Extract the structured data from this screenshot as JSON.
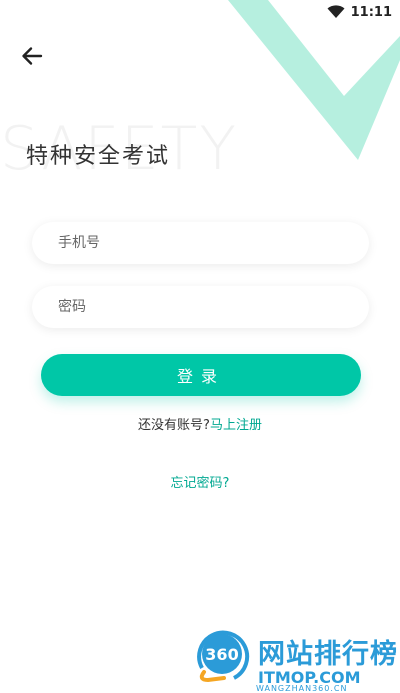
{
  "status_bar": {
    "time": "11:11",
    "wifi_icon": "wifi-icon"
  },
  "header": {
    "back_icon": "back-arrow-icon"
  },
  "background_text": "SAFETY",
  "page": {
    "title": "特种安全考试"
  },
  "form": {
    "phone_placeholder": "手机号",
    "password_placeholder": "密码",
    "login_label": "登录"
  },
  "links": {
    "no_account_text": "还没有账号?",
    "register_label": "马上注册",
    "forgot_label": "忘记密码?"
  },
  "watermark": {
    "logo_text": "360",
    "title": "网站排行榜",
    "domain": "ITMOP.COM",
    "subdomain": "WANGZHAN360.CN"
  },
  "colors": {
    "accent": "#00c7a7",
    "link": "#00a891",
    "decor": "#b6efdf",
    "watermark": "#2b9bd8"
  }
}
